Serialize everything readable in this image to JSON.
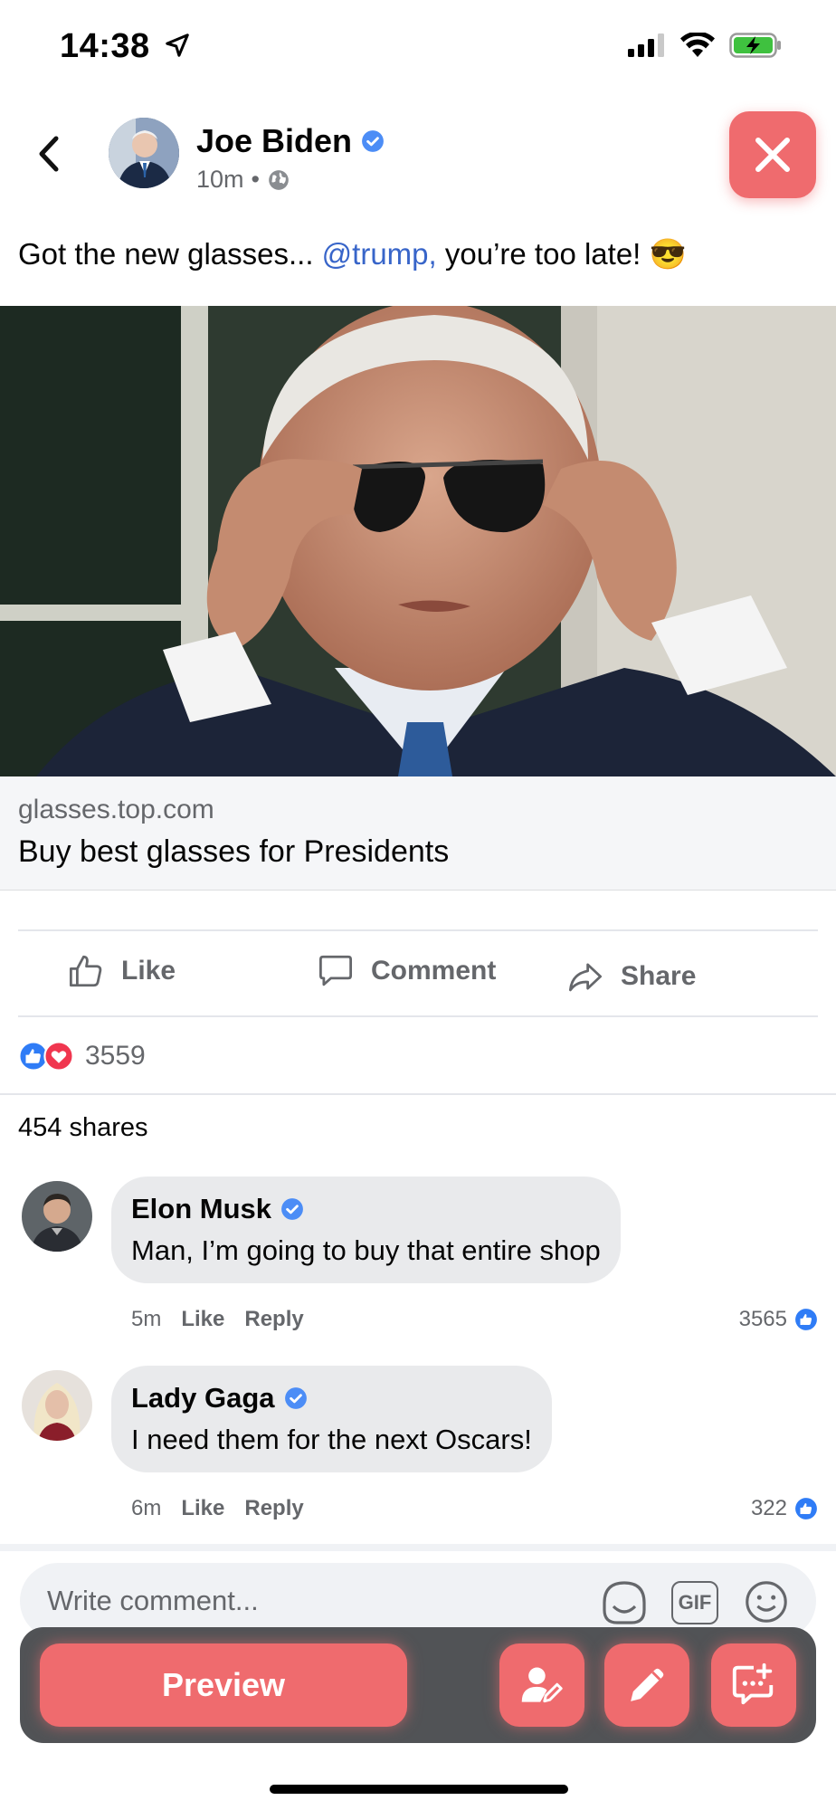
{
  "status_bar": {
    "time": "14:38"
  },
  "post": {
    "author": "Joe Biden",
    "time": "10m",
    "text_before": "Got the new glasses... ",
    "mention": "@trump,",
    "text_after": " you’re too late! 😎",
    "link": {
      "domain": "glasses.top.com",
      "title": "Buy best glasses for Presidents"
    },
    "actions": {
      "like": "Like",
      "comment": "Comment",
      "share": "Share"
    },
    "reactions_count": "3559",
    "shares": "454 shares"
  },
  "comments": [
    {
      "name": "Elon Musk",
      "text": "Man, I’m going to buy that entire shop",
      "time": "5m",
      "like": "Like",
      "reply": "Reply",
      "likes": "3565"
    },
    {
      "name": "Lady Gaga",
      "text": "I need them for the next Oscars!",
      "time": "6m",
      "like": "Like",
      "reply": "Reply",
      "likes": "322"
    }
  ],
  "composer": {
    "placeholder": "Write comment...",
    "gif": "GIF"
  },
  "toolbar": {
    "preview": "Preview"
  },
  "colors": {
    "accent": "#ef6b6e",
    "link": "#3865c9",
    "verified": "#4c8df6"
  }
}
